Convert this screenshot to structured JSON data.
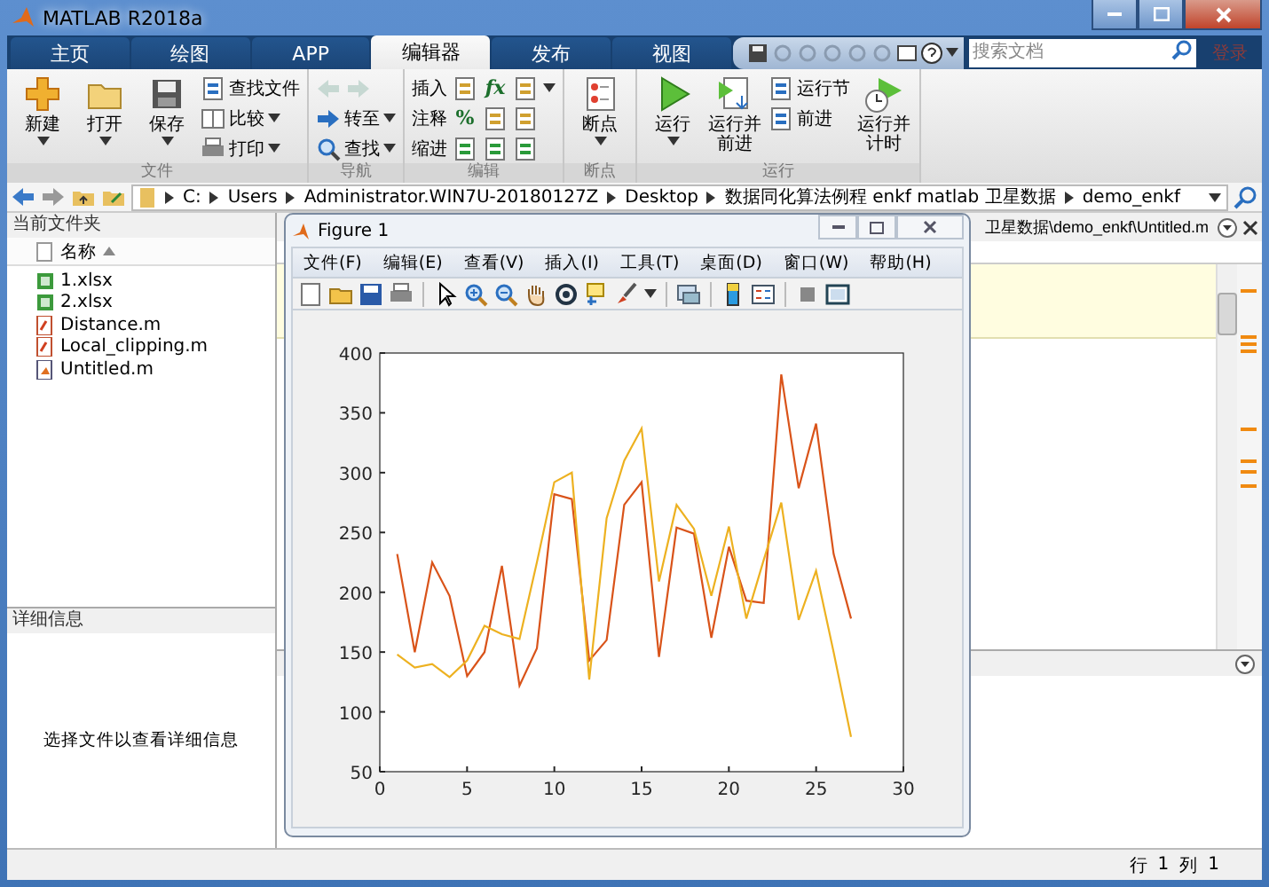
{
  "window": {
    "title": "MATLAB R2018a"
  },
  "tabs": [
    {
      "label": "主页",
      "selected": false
    },
    {
      "label": "绘图",
      "selected": false
    },
    {
      "label": "APP",
      "selected": false
    },
    {
      "label": "编辑器",
      "selected": true
    },
    {
      "label": "发布",
      "selected": false
    },
    {
      "label": "视图",
      "selected": false
    }
  ],
  "search": {
    "placeholder": "搜索文档"
  },
  "sign_in": "登录",
  "ribbon": [
    {
      "title": "文件",
      "items": [
        {
          "kind": "large",
          "label": "新建",
          "dropdown": true
        },
        {
          "kind": "large",
          "label": "打开",
          "dropdown": true
        },
        {
          "kind": "large",
          "label": "保存",
          "dropdown": true
        },
        {
          "kind": "column",
          "items": [
            {
              "label": "查找文件",
              "dropdown": false
            },
            {
              "label": "比较",
              "dropdown": true
            },
            {
              "label": "打印",
              "dropdown": true
            }
          ]
        }
      ]
    },
    {
      "title": "导航",
      "items": [
        {
          "kind": "column",
          "items": [
            {
              "kind": "arrows",
              "disabled": true
            },
            {
              "label": "转至",
              "dropdown": true
            },
            {
              "label": "查找",
              "dropdown": true
            }
          ]
        }
      ]
    },
    {
      "title": "编辑",
      "items": [
        {
          "kind": "rows",
          "rows": [
            {
              "label": "插入",
              "tools": [
                {
                  "kind": "icon"
                },
                {
                  "kind": "glyph",
                  "text": "fx"
                },
                {
                  "kind": "icon"
                },
                {
                  "kind": "caret"
                }
              ]
            },
            {
              "label": "注释",
              "tools": [
                {
                  "kind": "glyph",
                  "text": "%"
                },
                {
                  "kind": "icon"
                },
                {
                  "kind": "icon"
                }
              ]
            },
            {
              "label": "缩进",
              "tools": [
                {
                  "kind": "icon"
                },
                {
                  "kind": "icon"
                },
                {
                  "kind": "icon"
                }
              ]
            }
          ]
        }
      ]
    },
    {
      "title": "断点",
      "items": [
        {
          "kind": "large",
          "label": "断点",
          "dropdown": true
        }
      ]
    },
    {
      "title": "运行",
      "items": [
        {
          "kind": "large",
          "label": "运行",
          "dropdown": true
        },
        {
          "kind": "large",
          "label": "运行并前进",
          "dropdown": false
        },
        {
          "kind": "column",
          "items": [
            {
              "label": "运行节",
              "dropdown": false
            },
            {
              "label": "前进",
              "dropdown": false
            }
          ]
        },
        {
          "kind": "large",
          "label": "运行并计时",
          "dropdown": false
        }
      ]
    }
  ],
  "address": [
    "C:",
    "Users",
    "Administrator.WIN7U-20180127Z",
    "Desktop",
    "数据同化算法例程 enkf matlab 卫星数据",
    "demo_enkf"
  ],
  "current_folder": {
    "title": "当前文件夹",
    "column": "名称",
    "files": [
      {
        "name": "1.xlsx",
        "kind": "excel"
      },
      {
        "name": "2.xlsx",
        "kind": "excel"
      },
      {
        "name": "Distance.m",
        "kind": "function"
      },
      {
        "name": "Local_clipping.m",
        "kind": "function"
      },
      {
        "name": "Untitled.m",
        "kind": "script"
      }
    ]
  },
  "details": {
    "title": "详细信息",
    "message": "选择文件以查看详细信息"
  },
  "editor": {
    "path": "卫星数据\\demo_enkf\\Untitled.m"
  },
  "status_bar": {
    "row_label": "行",
    "row": "1",
    "col_label": "列",
    "col": "1"
  },
  "figure": {
    "title": "Figure 1",
    "menus": [
      "文件(F)",
      "编辑(E)",
      "查看(V)",
      "插入(I)",
      "工具(T)",
      "桌面(D)",
      "窗口(W)",
      "帮助(H)"
    ],
    "chart_data": {
      "type": "line",
      "x": [
        1,
        2,
        3,
        4,
        5,
        6,
        7,
        8,
        9,
        10,
        11,
        12,
        13,
        14,
        15,
        16,
        17,
        18,
        19,
        20,
        21,
        22,
        23,
        24,
        25,
        26,
        27
      ],
      "xlim": [
        0,
        30
      ],
      "ylim": [
        50,
        400
      ],
      "xticks": [
        0,
        5,
        10,
        15,
        20,
        25,
        30
      ],
      "yticks": [
        50,
        100,
        150,
        200,
        250,
        300,
        350,
        400
      ],
      "series": [
        {
          "color": "#d95319",
          "values": [
            232,
            150,
            225,
            197,
            130,
            150,
            222,
            122,
            153,
            282,
            278,
            143,
            160,
            273,
            292,
            146,
            254,
            249,
            162,
            238,
            193,
            191,
            382,
            287,
            341,
            232,
            178
          ]
        },
        {
          "color": "#edb120",
          "values": [
            148,
            137,
            140,
            129,
            143,
            172,
            165,
            161,
            225,
            292,
            300,
            127,
            262,
            310,
            337,
            209,
            273,
            253,
            197,
            255,
            178,
            227,
            275,
            177,
            218,
            150,
            79
          ]
        }
      ]
    }
  }
}
